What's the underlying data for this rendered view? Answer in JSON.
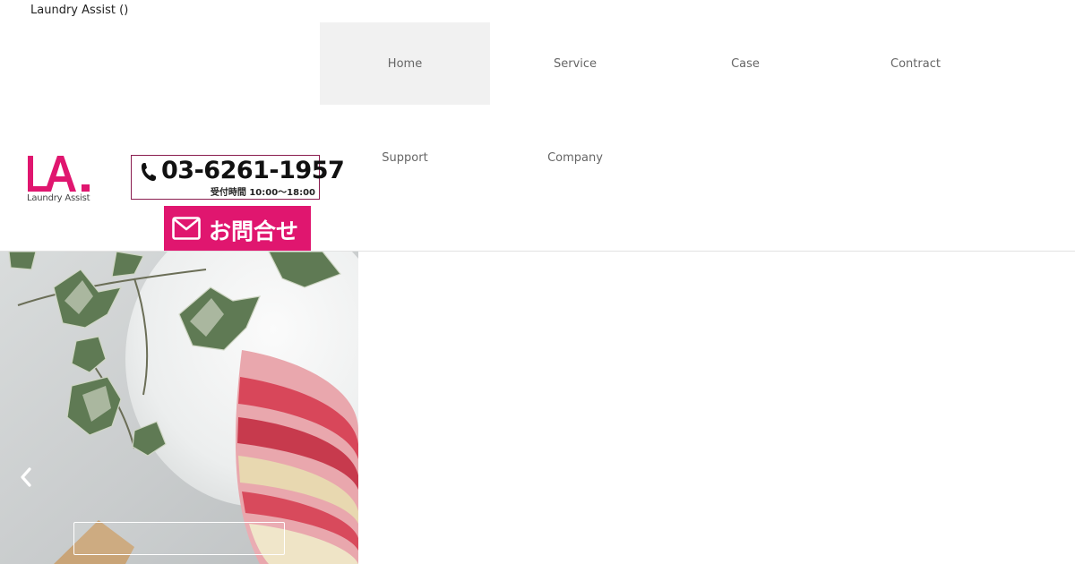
{
  "site": {
    "title": "Laundry Assist ()",
    "logo_text": "LA.",
    "logo_subtitle": "Laundry Assist",
    "brand_color": "#e0166f"
  },
  "contact": {
    "phone_number": "03-6261-1957",
    "hours": "受付時間 10:00～18:00",
    "contact_button_label": "お問合せ",
    "phone_icon": "phone-icon",
    "mail_icon": "mail-icon"
  },
  "nav": {
    "items": [
      {
        "label": "Home",
        "active": true
      },
      {
        "label": "Service",
        "active": false
      },
      {
        "label": "Case",
        "active": false
      },
      {
        "label": "Contract",
        "active": false
      },
      {
        "label": "Support",
        "active": false
      },
      {
        "label": "Company",
        "active": false
      }
    ]
  },
  "hero": {
    "prev_icon": "chevron-left-icon",
    "caption": ""
  }
}
